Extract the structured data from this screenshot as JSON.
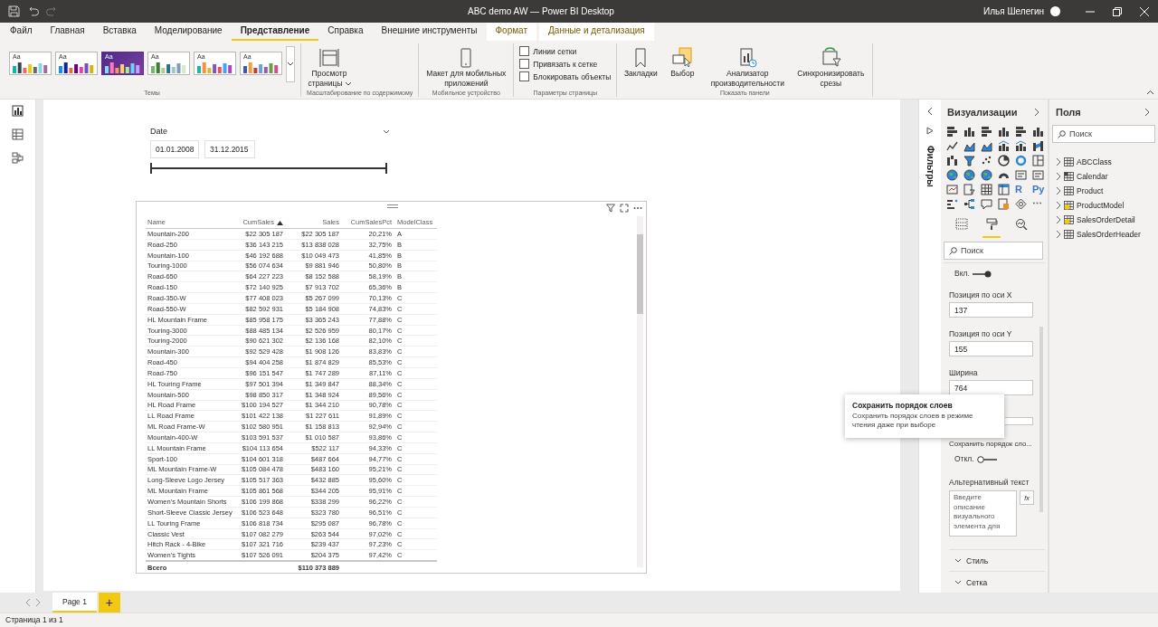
{
  "window": {
    "title": "ABC demo AW — Power BI Desktop",
    "user": "Илья Шелегин"
  },
  "ribbon_tabs": [
    {
      "label": "Файл",
      "selected": false,
      "kind": "normal"
    },
    {
      "label": "Главная",
      "selected": false,
      "kind": "normal"
    },
    {
      "label": "Вставка",
      "selected": false,
      "kind": "normal"
    },
    {
      "label": "Моделирование",
      "selected": false,
      "kind": "normal"
    },
    {
      "label": "Представление",
      "selected": true,
      "kind": "normal"
    },
    {
      "label": "Справка",
      "selected": false,
      "kind": "normal"
    },
    {
      "label": "Внешние инструменты",
      "selected": false,
      "kind": "normal"
    },
    {
      "label": "Формат",
      "selected": false,
      "kind": "contextual"
    },
    {
      "label": "Данные и детализация",
      "selected": false,
      "kind": "contextual"
    }
  ],
  "ribbon_groups": [
    {
      "kind": "themes",
      "label": "Темы",
      "themes": [
        {
          "label": "Aa",
          "kind": "light"
        },
        {
          "label": "Aa",
          "kind": "light"
        },
        {
          "label": "Aa",
          "kind": "dark"
        },
        {
          "label": "Aa",
          "kind": "light"
        },
        {
          "label": "Aa",
          "kind": "light"
        },
        {
          "label": "Aa",
          "kind": "light"
        }
      ]
    },
    {
      "kind": "buttons",
      "label": "Масштабирование по содержимому",
      "buttons": [
        {
          "label": "Просмотр страницы",
          "kind": "view",
          "dropdown": true
        }
      ]
    },
    {
      "kind": "buttons",
      "label": "Мобильное устройство",
      "buttons": [
        {
          "label": "Макет для мобильных приложений",
          "kind": "mobile",
          "dropdown": false
        }
      ]
    },
    {
      "kind": "checks",
      "label": "Параметры страницы",
      "items": [
        {
          "label": "Линии сетки",
          "checked": false
        },
        {
          "label": "Привязать к сетке",
          "checked": false
        },
        {
          "label": "Блокировать объекты",
          "checked": false
        }
      ]
    },
    {
      "kind": "buttons",
      "label": "Показать панели",
      "buttons": [
        {
          "label": "Закладки",
          "kind": "bookmarks",
          "dropdown": false
        },
        {
          "label": "Выбор",
          "kind": "selection",
          "dropdown": false
        },
        {
          "label": "Анализатор производительности",
          "kind": "performance",
          "dropdown": false
        },
        {
          "label": "Синхронизировать срезы",
          "kind": "sync",
          "dropdown": false
        }
      ]
    }
  ],
  "slicer": {
    "title": "Date",
    "start": "01.01.2008",
    "end": "31.12.2015",
    "level": 1
  },
  "table": {
    "columns": [
      {
        "label": "Name",
        "kind": "text",
        "sorted": false
      },
      {
        "label": "CumSales",
        "kind": "number",
        "sorted": true
      },
      {
        "label": "Sales",
        "kind": "number",
        "sorted": false
      },
      {
        "label": "CumSalesPct",
        "kind": "number",
        "sorted": false
      },
      {
        "label": "ModelClass",
        "kind": "text",
        "sorted": false
      }
    ],
    "rows": [
      [
        "Mountain-200",
        "$22 305 187",
        "$22 305 187",
        "20,21%",
        "A"
      ],
      [
        "Road-250",
        "$36 143 215",
        "$13 838 028",
        "32,75%",
        "B"
      ],
      [
        "Mountain-100",
        "$46 192 688",
        "$10 049 473",
        "41,85%",
        "B"
      ],
      [
        "Touring-1000",
        "$56 074 634",
        "$9 881 946",
        "50,80%",
        "B"
      ],
      [
        "Road-650",
        "$64 227 223",
        "$8 152 588",
        "58,19%",
        "B"
      ],
      [
        "Road-150",
        "$72 140 925",
        "$7 913 702",
        "65,36%",
        "B"
      ],
      [
        "Road-350-W",
        "$77 408 023",
        "$5 267 099",
        "70,13%",
        "C"
      ],
      [
        "Road-550-W",
        "$82 592 931",
        "$5 184 908",
        "74,83%",
        "C"
      ],
      [
        "HL Mountain Frame",
        "$85 958 175",
        "$3 365 243",
        "77,88%",
        "C"
      ],
      [
        "Touring-3000",
        "$88 485 134",
        "$2 526 959",
        "80,17%",
        "C"
      ],
      [
        "Touring-2000",
        "$90 621 302",
        "$2 136 168",
        "82,10%",
        "C"
      ],
      [
        "Mountain-300",
        "$92 529 428",
        "$1 908 126",
        "83,83%",
        "C"
      ],
      [
        "Road-450",
        "$94 404 258",
        "$1 874 829",
        "85,53%",
        "C"
      ],
      [
        "Road-750",
        "$96 151 547",
        "$1 747 289",
        "87,11%",
        "C"
      ],
      [
        "HL Touring Frame",
        "$97 501 394",
        "$1 349 847",
        "88,34%",
        "C"
      ],
      [
        "Mountain-500",
        "$98 850 317",
        "$1 348 924",
        "89,56%",
        "C"
      ],
      [
        "HL Road Frame",
        "$100 194 527",
        "$1 344 210",
        "90,78%",
        "C"
      ],
      [
        "LL Road Frame",
        "$101 422 138",
        "$1 227 611",
        "91,89%",
        "C"
      ],
      [
        "ML Road Frame-W",
        "$102 580 951",
        "$1 158 813",
        "92,94%",
        "C"
      ],
      [
        "Mountain-400-W",
        "$103 591 537",
        "$1 010 587",
        "93,86%",
        "C"
      ],
      [
        "LL Mountain Frame",
        "$104 113 654",
        "$522 117",
        "94,33%",
        "C"
      ],
      [
        "Sport-100",
        "$104 601 318",
        "$487 664",
        "94,77%",
        "C"
      ],
      [
        "ML Mountain Frame-W",
        "$105 084 478",
        "$483 160",
        "95,21%",
        "C"
      ],
      [
        "Long-Sleeve Logo Jersey",
        "$105 517 363",
        "$432 885",
        "95,60%",
        "C"
      ],
      [
        "ML Mountain Frame",
        "$105 861 568",
        "$344 205",
        "95,91%",
        "C"
      ],
      [
        "Women's Mountain Shorts",
        "$106 199 868",
        "$338 299",
        "96,22%",
        "C"
      ],
      [
        "Short-Sleeve Classic Jersey",
        "$106 523 648",
        "$323 780",
        "96,51%",
        "C"
      ],
      [
        "LL Touring Frame",
        "$106 818 734",
        "$295 087",
        "96,78%",
        "C"
      ],
      [
        "Classic Vest",
        "$107 082 279",
        "$263 544",
        "97,02%",
        "C"
      ],
      [
        "Hitch Rack - 4-Bike",
        "$107 321 716",
        "$239 437",
        "97,23%",
        "C"
      ],
      [
        "Women's Tights",
        "$107 526 091",
        "$204 375",
        "97,42%",
        "C"
      ]
    ],
    "total": {
      "label": "Всего",
      "sales": "$110 373 889"
    }
  },
  "filters_pane": {
    "label": "Фильтры"
  },
  "visualizations": {
    "title": "Визуализации",
    "types": [
      {
        "kind": "bar"
      },
      {
        "kind": "column"
      },
      {
        "kind": "bar"
      },
      {
        "kind": "column"
      },
      {
        "kind": "bar"
      },
      {
        "kind": "column"
      },
      {
        "kind": "line"
      },
      {
        "kind": "area"
      },
      {
        "kind": "area"
      },
      {
        "kind": "combo"
      },
      {
        "kind": "combo"
      },
      {
        "kind": "ribbon"
      },
      {
        "kind": "waterfall"
      },
      {
        "kind": "funnel"
      },
      {
        "kind": "scatter"
      },
      {
        "kind": "pie"
      },
      {
        "kind": "donut"
      },
      {
        "kind": "treemap"
      },
      {
        "kind": "map"
      },
      {
        "kind": "map"
      },
      {
        "kind": "map"
      },
      {
        "kind": "gauge"
      },
      {
        "kind": "card"
      },
      {
        "kind": "card"
      },
      {
        "kind": "kpi"
      },
      {
        "kind": "slicer"
      },
      {
        "kind": "table"
      },
      {
        "kind": "matrix"
      },
      {
        "kind": "script",
        "label": "R"
      },
      {
        "kind": "script",
        "label": "Py"
      },
      {
        "kind": "influencers"
      },
      {
        "kind": "tree"
      },
      {
        "kind": "bubble"
      },
      {
        "kind": "narrative"
      },
      {
        "kind": "diamond"
      },
      {
        "kind": "more",
        "label": "⋯"
      }
    ],
    "pane_tabs": [
      {
        "kind": "fields",
        "selected": false
      },
      {
        "kind": "format",
        "selected": true
      },
      {
        "kind": "analytics",
        "selected": false
      }
    ],
    "search": {
      "placeholder": "Поиск"
    },
    "options": [
      {
        "kind": "toggle",
        "label": "Вкл.",
        "on": true
      },
      {
        "kind": "field",
        "label": "Позиция по оси X",
        "value": "137"
      },
      {
        "kind": "field",
        "label": "Позиция по оси Y",
        "value": "155"
      },
      {
        "kind": "field",
        "label": "Ширина",
        "value": "764"
      },
      {
        "kind": "field"
      },
      {
        "kind": "heading",
        "label": "Сохранить порядок сло..."
      },
      {
        "kind": "toggle",
        "label": "Откл.",
        "on": false
      },
      {
        "kind": "textarea",
        "label": "Альтернативный текст",
        "placeholder": "Введите описание визуального элемента для",
        "button": "fx"
      }
    ],
    "sections": [
      {
        "label": "Стиль",
        "expanded": false
      },
      {
        "label": "Сетка",
        "expanded": false
      }
    ]
  },
  "fields": {
    "title": "Поля",
    "search": {
      "placeholder": "Поиск"
    },
    "tables": [
      {
        "label": "ABCClass",
        "kind": "table",
        "expanded": false
      },
      {
        "label": "Calendar",
        "kind": "date",
        "expanded": false
      },
      {
        "label": "Product",
        "kind": "table",
        "expanded": false
      },
      {
        "label": "ProductModel",
        "kind": "calculated",
        "expanded": false
      },
      {
        "label": "SalesOrderDetail",
        "kind": "calculated",
        "expanded": false
      },
      {
        "label": "SalesOrderHeader",
        "kind": "table",
        "expanded": false
      }
    ]
  },
  "tooltip": {
    "title": "Сохранить порядок слоев",
    "text": "Сохранить порядок слоев в режиме чтения даже при выборе"
  },
  "pages": [
    {
      "label": "Page 1",
      "selected": true
    }
  ],
  "add_page": "+",
  "status_bar": "Страница 1 из 1"
}
